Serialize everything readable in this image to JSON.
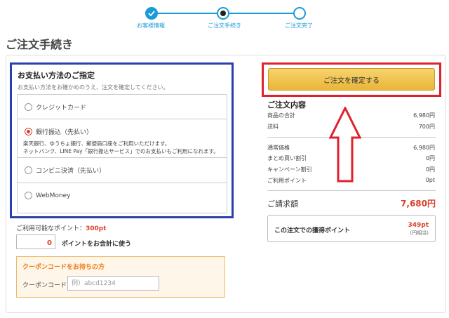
{
  "stepper": {
    "steps": [
      {
        "label": "お客様情報"
      },
      {
        "label": "ご注文手続き"
      },
      {
        "label": "ご注文完了"
      }
    ]
  },
  "page_title": "ご注文手続き",
  "payment": {
    "title": "お支払い方法のご指定",
    "subtitle": "お支払い方法をお確かめのうえ、注文を確定してください。",
    "options": [
      {
        "label": "クレジットカード",
        "selected": false
      },
      {
        "label": "銀行振込（先払い）",
        "selected": true,
        "desc1": "楽天銀行、ゆうちょ銀行、郵便局口座をご利用いただけます。",
        "desc2": "ネットバンク、LINE Pay「銀行振込サービス」でのお支払いもご利用になれます。"
      },
      {
        "label": "コンビニ決済（先払い）",
        "selected": false
      },
      {
        "label": "WebMoney",
        "selected": false
      }
    ]
  },
  "points": {
    "label": "ご利用可能なポイント：",
    "available": "300pt",
    "input_value": "0",
    "use_label": "ポイントをお会計に使う"
  },
  "coupon": {
    "title": "クーポンコードをお持ちの方",
    "label": "クーポンコード",
    "placeholder": "例）abcd1234"
  },
  "summary": {
    "confirm_button": "ご注文を確定する",
    "title": "ご注文内容",
    "rows": [
      {
        "label": "商品の合計",
        "value": "6,980円"
      },
      {
        "label": "送料",
        "value": "700円"
      },
      {
        "label": "通常価格",
        "value": "6,980円"
      },
      {
        "label": "まとめ買い割引",
        "value": "0円"
      },
      {
        "label": "キャンペーン割引",
        "value": "0円"
      },
      {
        "label": "ご利用ポイント",
        "value": "0pt"
      }
    ],
    "total_label": "ご請求額",
    "total_value": "7,680円",
    "earned_label": "この注文での獲得ポイント",
    "earned_value": "349pt",
    "earned_note": "(円相当)"
  },
  "colors": {
    "accent_blue": "#1a9bd7",
    "price_red": "#d9402c",
    "annotation_red": "#e0202c",
    "annotation_blue": "#2b3fae",
    "button_gold": "#eab53a"
  }
}
